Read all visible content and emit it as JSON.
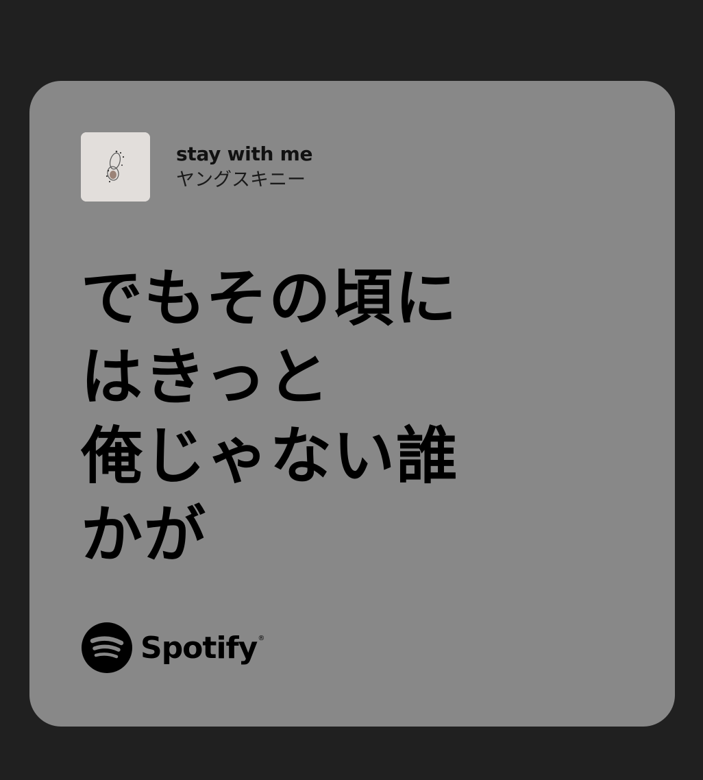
{
  "track": {
    "title": "stay with me",
    "artist": "ヤングスキニー",
    "cover_icon": "album-cover-image"
  },
  "lyric": {
    "text": "でもその頃に\nはきっと\n俺じゃない誰\nかが"
  },
  "brand": {
    "name": "Spotify",
    "registered_mark": "®",
    "icon": "spotify-logo-icon"
  },
  "colors": {
    "background": "#202020",
    "card": "#888888",
    "text": "#000000"
  }
}
